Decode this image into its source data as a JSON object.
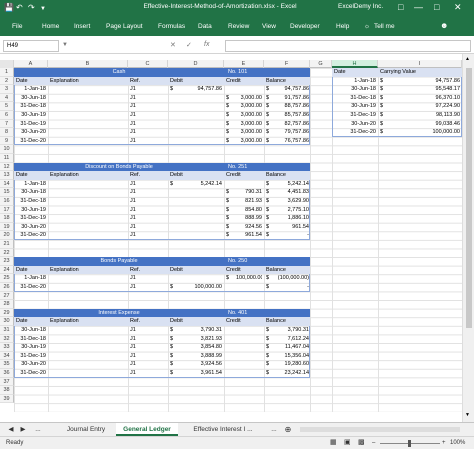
{
  "titlebar": {
    "title": "Effective-Interest-Method-of-Amortization.xlsx - Excel",
    "user": "ExcelDemy Inc.",
    "save_icon": "save-icon",
    "undo_icon": "undo-icon",
    "redo_icon": "redo-icon"
  },
  "ribbon": {
    "tabs": [
      "File",
      "Home",
      "Insert",
      "Page Layout",
      "Formulas",
      "Data",
      "Review",
      "View",
      "Developer",
      "Help",
      "Tell me"
    ]
  },
  "formula_bar": {
    "name_box": "H49",
    "cancel": "✕",
    "enter": "✓",
    "fx": "fx",
    "value": ""
  },
  "columns": [
    "A",
    "B",
    "C",
    "D",
    "E",
    "F",
    "G",
    "H",
    "I"
  ],
  "rows": [
    "1",
    "2",
    "3",
    "4",
    "5",
    "6",
    "7",
    "8",
    "9",
    "10",
    "11",
    "12",
    "13",
    "14",
    "15",
    "16",
    "17",
    "18",
    "19",
    "20",
    "21",
    "22",
    "23",
    "24",
    "25",
    "26",
    "27",
    "28",
    "29",
    "30",
    "31",
    "32",
    "33",
    "34",
    "35",
    "36",
    "37",
    "38",
    "39"
  ],
  "cash": {
    "title": "Cash",
    "no": "No. 101",
    "headers": [
      "Date",
      "Explanation",
      "Ref.",
      "Debit",
      "Credit",
      "Balance"
    ],
    "rows": [
      [
        "1-Jan-18",
        "",
        "J1",
        "$",
        "94,757.86",
        "",
        "",
        "$",
        "94,757.86"
      ],
      [
        "30-Jun-18",
        "",
        "J1",
        "",
        "",
        "$",
        "3,000.00",
        "$",
        "91,757.86"
      ],
      [
        "31-Dec-18",
        "",
        "J1",
        "",
        "",
        "$",
        "3,000.00",
        "$",
        "88,757.86"
      ],
      [
        "30-Jun-19",
        "",
        "J1",
        "",
        "",
        "$",
        "3,000.00",
        "$",
        "85,757.86"
      ],
      [
        "31-Dec-19",
        "",
        "J1",
        "",
        "",
        "$",
        "3,000.00",
        "$",
        "82,757.86"
      ],
      [
        "30-Jun-20",
        "",
        "J1",
        "",
        "",
        "$",
        "3,000.00",
        "$",
        "79,757.86"
      ],
      [
        "31-Dec-20",
        "",
        "J1",
        "",
        "",
        "$",
        "3,000.00",
        "$",
        "76,757.86"
      ]
    ]
  },
  "discount": {
    "title": "Discount on Bonds Payable",
    "no": "No. 251",
    "headers": [
      "Date",
      "Explanation",
      "Ref.",
      "Debit",
      "Credit",
      "Balance"
    ],
    "rows": [
      [
        "1-Jan-18",
        "",
        "J1",
        "$",
        "5,242.14",
        "",
        "",
        "$",
        "5,242.14"
      ],
      [
        "30-Jun-18",
        "",
        "J1",
        "",
        "",
        "$",
        "790.31",
        "$",
        "4,451.83"
      ],
      [
        "31-Dec-18",
        "",
        "J1",
        "",
        "",
        "$",
        "821.93",
        "$",
        "3,629.90"
      ],
      [
        "30-Jun-19",
        "",
        "J1",
        "",
        "",
        "$",
        "854.80",
        "$",
        "2,775.10"
      ],
      [
        "31-Dec-19",
        "",
        "J1",
        "",
        "",
        "$",
        "888.99",
        "$",
        "1,886.10"
      ],
      [
        "30-Jun-20",
        "",
        "J1",
        "",
        "",
        "$",
        "924.56",
        "$",
        "961.54"
      ],
      [
        "31-Dec-20",
        "",
        "J1",
        "",
        "",
        "$",
        "961.54",
        "$",
        "-"
      ]
    ]
  },
  "bonds": {
    "title": "Bonds Payable",
    "no": "No. 250",
    "headers": [
      "Date",
      "Explanation",
      "Ref.",
      "Debit",
      "Credit",
      "Balance"
    ],
    "rows": [
      [
        "1-Jan-18",
        "",
        "J1",
        "",
        "",
        "$",
        "100,000.00",
        "$",
        "(100,000.00)"
      ],
      [
        "31-Dec-20",
        "",
        "J1",
        "$",
        "100,000.00",
        "",
        "",
        "$",
        "-"
      ]
    ]
  },
  "interest": {
    "title": "Interest Expense",
    "no": "No. 401",
    "headers": [
      "Date",
      "Explanation",
      "Ref.",
      "Debit",
      "Credit",
      "Balance"
    ],
    "rows": [
      [
        "30-Jun-18",
        "",
        "J1",
        "$",
        "3,790.31",
        "",
        "",
        "$",
        "3,790.31"
      ],
      [
        "31-Dec-18",
        "",
        "J1",
        "$",
        "3,821.93",
        "",
        "",
        "$",
        "7,612.24"
      ],
      [
        "30-Jun-19",
        "",
        "J1",
        "$",
        "3,854.80",
        "",
        "",
        "$",
        "11,467.04"
      ],
      [
        "31-Dec-19",
        "",
        "J1",
        "$",
        "3,888.99",
        "",
        "",
        "$",
        "15,356.04"
      ],
      [
        "30-Jun-20",
        "",
        "J1",
        "$",
        "3,924.56",
        "",
        "",
        "$",
        "19,280.60"
      ],
      [
        "31-Dec-20",
        "",
        "J1",
        "$",
        "3,961.54",
        "",
        "",
        "$",
        "23,242.14"
      ]
    ]
  },
  "carrying": {
    "headers": [
      "Date",
      "Carrying Value"
    ],
    "rows": [
      [
        "1-Jan-18",
        "$",
        "94,757.86"
      ],
      [
        "30-Jun-18",
        "$",
        "95,548.17"
      ],
      [
        "31-Dec-18",
        "$",
        "96,370.10"
      ],
      [
        "30-Jun-19",
        "$",
        "97,224.90"
      ],
      [
        "31-Dec-19",
        "$",
        "98,113.90"
      ],
      [
        "30-Jun-20",
        "$",
        "99,038.46"
      ],
      [
        "31-Dec-20",
        "$",
        "100,000.00"
      ]
    ]
  },
  "sheets": {
    "tabs": [
      "Journal Entry",
      "General Ledger",
      "Effective Interest I ..."
    ],
    "active": "General Ledger",
    "ellipsis": "...",
    "add": "⊕"
  },
  "status": {
    "ready": "Ready",
    "zoom": "100%"
  },
  "colors": {
    "excel_green": "#217346",
    "header_blue": "#4472c4",
    "subheader_blue": "#d9e1f2"
  }
}
